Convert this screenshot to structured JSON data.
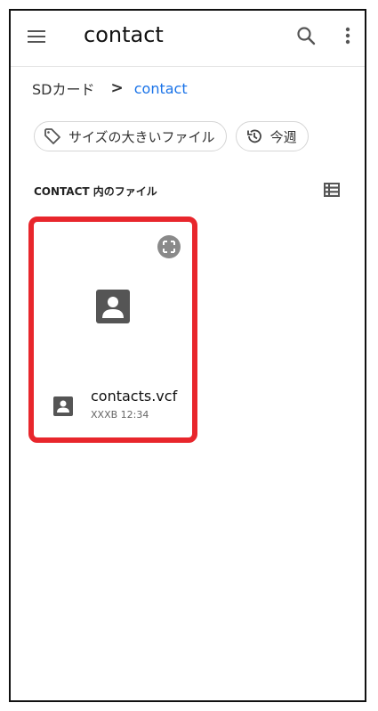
{
  "appbar": {
    "title": "contact",
    "icons": [
      "menu-icon",
      "search-icon",
      "more-vert-icon"
    ]
  },
  "breadcrumb": {
    "root": "SDカード",
    "separator": ">",
    "current": "contact"
  },
  "chips": [
    {
      "label": "サイズの大きいファイル",
      "icon": "tag-icon"
    },
    {
      "label": "今週",
      "icon": "history-icon"
    }
  ],
  "section": {
    "title": "CONTACT 内のファイル",
    "view_toggle_icon": "list-view-icon"
  },
  "file": {
    "name": "contacts.vcf",
    "meta": "XXXB 12:34",
    "icon": "contact-file-icon"
  },
  "colors": {
    "accent": "#1a73e8",
    "highlight": "#e8262c",
    "icon": "#555555"
  }
}
